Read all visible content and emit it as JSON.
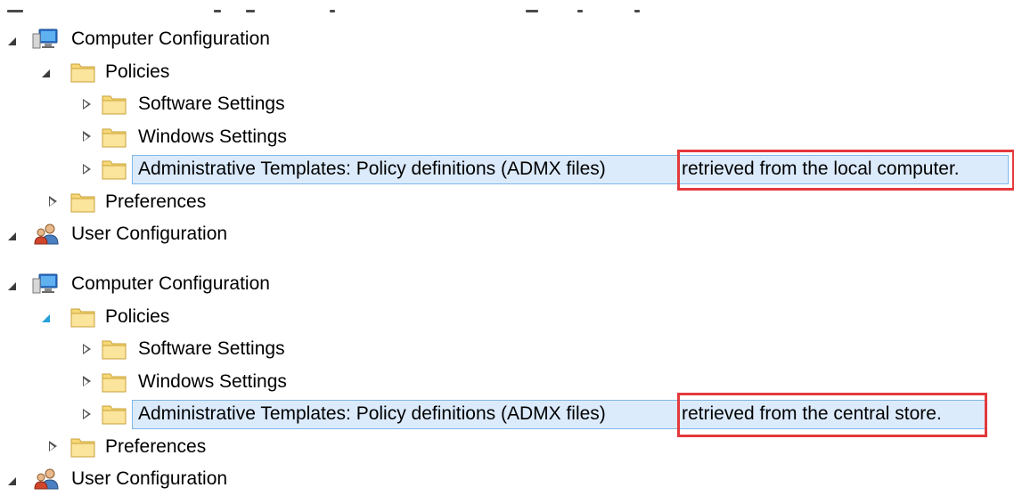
{
  "trees": [
    {
      "computer_config_label": "Computer Configuration",
      "policies_label": "Policies",
      "software_settings_label": "Software Settings",
      "windows_settings_label": "Windows Settings",
      "admin_templates_label": "Administrative Templates: Policy definitions (ADMX files)",
      "admin_templates_suffix": "retrieved from the local computer.",
      "preferences_label": "Preferences",
      "user_config_label": "User Configuration"
    },
    {
      "computer_config_label": "Computer Configuration",
      "policies_label": "Policies",
      "software_settings_label": "Software Settings",
      "windows_settings_label": "Windows Settings",
      "admin_templates_label": "Administrative Templates: Policy definitions (ADMX files)",
      "admin_templates_suffix": "retrieved from the central store.",
      "preferences_label": "Preferences",
      "user_config_label": "User Configuration"
    }
  ],
  "colors": {
    "selection_bg": "#dcebfc",
    "selection_border": "#7fb8e8",
    "highlight_box": "#e4393c",
    "folder": "#f6d877"
  },
  "icons": [
    "computer-icon",
    "folder-icon",
    "users-icon",
    "expand-arrow-icon",
    "collapse-arrow-icon"
  ]
}
